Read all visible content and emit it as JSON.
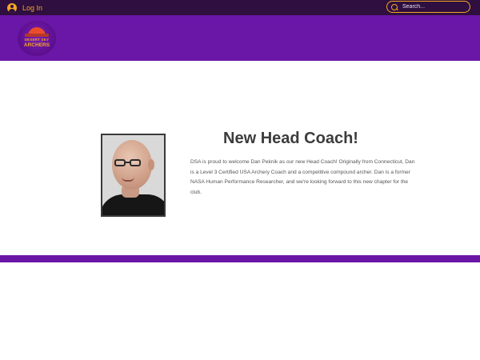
{
  "topbar": {
    "login_label": "Log In",
    "search_placeholder": "Search..."
  },
  "header": {
    "logo_line1": "DESERT SKY",
    "logo_line2": "ARCHERS"
  },
  "feature": {
    "title": "New Head Coach!",
    "body": "DSA is proud to welcome Dan Peknik as our new Head Coach! Originally from Connecticut, Dan is a Level 3 Certified USA Archery Coach and a competitive compound archer. Dan is a former NASA Human Performance Researcher, and we're looking forward to this new chapter for the club."
  },
  "icons": {
    "login": "user-circle-icon",
    "search": "search-icon"
  },
  "colors": {
    "topbar": "#2e0f3f",
    "brand_purple": "#6a16a6",
    "accent_orange": "#f5a623",
    "heading": "#3c3c3c",
    "body_text": "#555555"
  }
}
